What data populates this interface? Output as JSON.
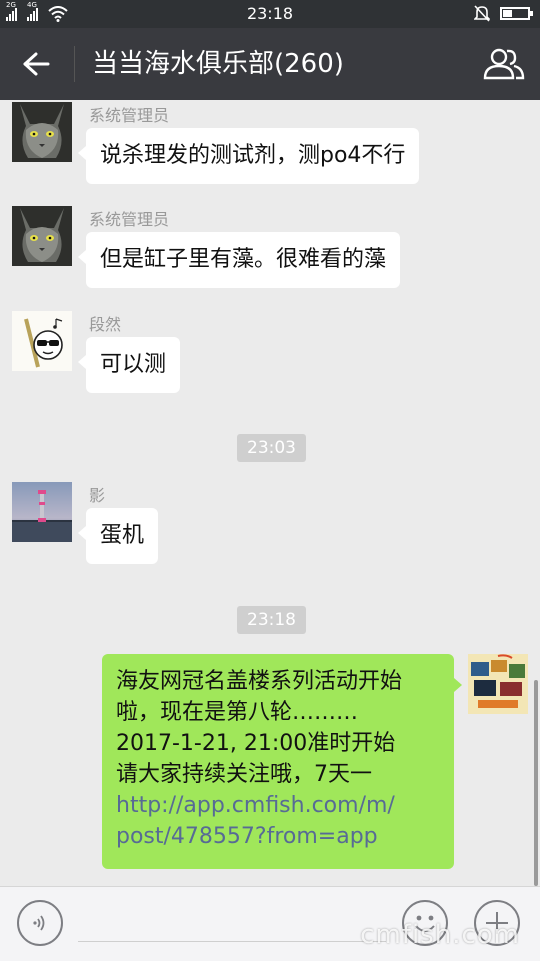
{
  "status_bar": {
    "sim1_label": "2G",
    "sim2_label": "4G",
    "time": "23:18",
    "icons": [
      "signal-icon",
      "signal-icon",
      "wifi-icon",
      "mute-icon",
      "battery-icon"
    ]
  },
  "header": {
    "title": "当当海水俱乐部(260)",
    "back_icon": "arrow-left-icon",
    "members_icon": "group-members-icon"
  },
  "messages": [
    {
      "sender": "系统管理员",
      "text": "说杀理发的测试剂，测po4不行",
      "avatar": "cat-avatar"
    },
    {
      "sender": "系统管理员",
      "text": "但是缸子里有藻。很难看的藻",
      "avatar": "cat-avatar"
    },
    {
      "sender": "段然",
      "text": "可以测",
      "avatar": "cartoon-avatar"
    },
    {
      "timestamp": "23:03"
    },
    {
      "sender": "影",
      "text": "蛋机",
      "avatar": "lighthouse-avatar"
    },
    {
      "timestamp": "23:18"
    }
  ],
  "outgoing": {
    "lines": [
      "海友网冠名盖楼系列活动开始",
      "啦，现在是第八轮………",
      "2017-1-21, 21:00准时开始",
      "请大家持续关注哦，7天一"
    ],
    "link_lines": [
      "http://app.cmfish.com/m/",
      "post/478557?from=app"
    ],
    "avatar": "promo-avatar"
  },
  "input_bar": {
    "voice_icon": "voice-icon",
    "emoji_icon": "emoji-icon",
    "plus_icon": "plus-icon"
  },
  "watermark": "cmfish.com",
  "colors": {
    "title_bar": "#393a3f",
    "chat_bg": "#ebebeb",
    "incoming_bubble": "#ffffff",
    "outgoing_bubble": "#a0e75a",
    "link": "#576b95"
  }
}
